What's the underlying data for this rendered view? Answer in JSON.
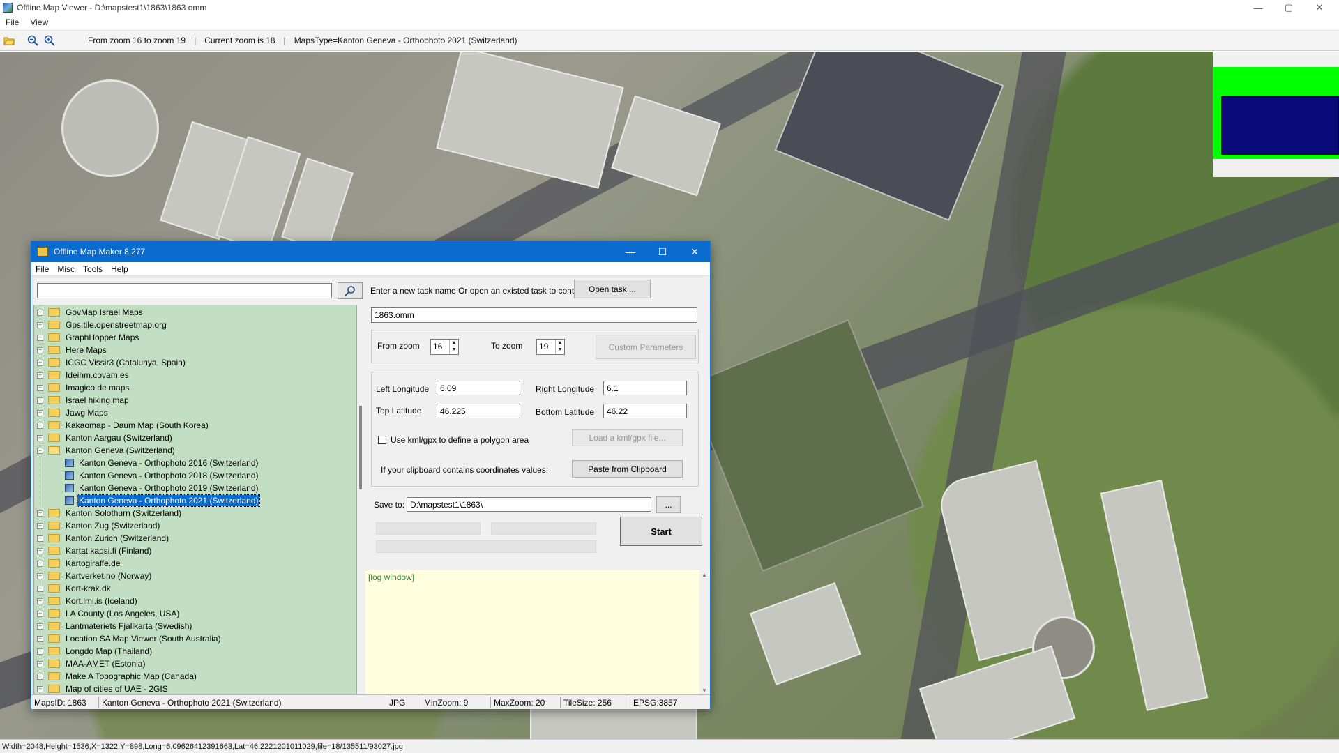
{
  "viewer": {
    "title": "Offline Map Viewer - D:\\mapstest1\\1863\\1863.omm",
    "menu": [
      "File",
      "View"
    ],
    "toolbar": {
      "zoom_range": "From zoom 16 to zoom 19",
      "current_zoom": "Current zoom is 18",
      "maps_type": "MapsType=Kanton Geneva - Orthophoto 2021 (Switzerland)",
      "separator": "|"
    },
    "status": "Width=2048,Height=1536,X=1322,Y=898,Long=6.09626412391663,Lat=46.2221201011029,file=18/135511/93027.jpg",
    "window_controls": {
      "minimize": "—",
      "maximize": "▢",
      "close": "✕"
    }
  },
  "dialog": {
    "title": "Offline Map Maker 8.277",
    "menu": [
      "File",
      "Misc",
      "Tools",
      "Help"
    ],
    "search": {
      "value": "",
      "placeholder": ""
    },
    "tree": [
      {
        "label": "GovMap Israel Maps",
        "level": 0,
        "expanded": false
      },
      {
        "label": "Gps.tile.openstreetmap.org",
        "level": 0,
        "expanded": false
      },
      {
        "label": "GraphHopper Maps",
        "level": 0,
        "expanded": false
      },
      {
        "label": "Here Maps",
        "level": 0,
        "expanded": false
      },
      {
        "label": "ICGC Vissir3 (Catalunya, Spain)",
        "level": 0,
        "expanded": false
      },
      {
        "label": "Ideihm.covam.es",
        "level": 0,
        "expanded": false
      },
      {
        "label": "Imagico.de maps",
        "level": 0,
        "expanded": false
      },
      {
        "label": "Israel hiking map",
        "level": 0,
        "expanded": false
      },
      {
        "label": "Jawg Maps",
        "level": 0,
        "expanded": false
      },
      {
        "label": "Kakaomap - Daum Map (South Korea)",
        "level": 0,
        "expanded": false
      },
      {
        "label": "Kanton Aargau (Switzerland)",
        "level": 0,
        "expanded": false
      },
      {
        "label": "Kanton Geneva (Switzerland)",
        "level": 0,
        "expanded": true
      },
      {
        "label": "Kanton Geneva - Orthophoto 2016 (Switzerland)",
        "level": 1
      },
      {
        "label": "Kanton Geneva - Orthophoto 2018 (Switzerland)",
        "level": 1
      },
      {
        "label": "Kanton Geneva - Orthophoto 2019 (Switzerland)",
        "level": 1
      },
      {
        "label": "Kanton Geneva - Orthophoto 2021 (Switzerland)",
        "level": 1,
        "selected": true
      },
      {
        "label": "Kanton Solothurn (Switzerland)",
        "level": 0,
        "expanded": false
      },
      {
        "label": "Kanton Zug (Switzerland)",
        "level": 0,
        "expanded": false
      },
      {
        "label": "Kanton Zurich (Switzerland)",
        "level": 0,
        "expanded": false
      },
      {
        "label": "Kartat.kapsi.fi (Finland)",
        "level": 0,
        "expanded": false
      },
      {
        "label": "Kartogiraffe.de",
        "level": 0,
        "expanded": false
      },
      {
        "label": "Kartverket.no (Norway)",
        "level": 0,
        "expanded": false
      },
      {
        "label": "Kort-krak.dk",
        "level": 0,
        "expanded": false
      },
      {
        "label": "Kort.lmi.is (Iceland)",
        "level": 0,
        "expanded": false
      },
      {
        "label": "LA County (Los Angeles, USA)",
        "level": 0,
        "expanded": false
      },
      {
        "label": "Lantmateriets Fjallkarta (Swedish)",
        "level": 0,
        "expanded": false
      },
      {
        "label": "Location SA Map Viewer (South Australia)",
        "level": 0,
        "expanded": false
      },
      {
        "label": "Longdo Map (Thailand)",
        "level": 0,
        "expanded": false
      },
      {
        "label": "MAA-AMET (Estonia)",
        "level": 0,
        "expanded": false
      },
      {
        "label": "Make A Topographic Map (Canada)",
        "level": 0,
        "expanded": false
      },
      {
        "label": "Map of cities of UAE - 2GIS",
        "level": 0,
        "expanded": false
      }
    ],
    "task": {
      "prompt": "Enter a new task name Or open an existed task to continue:",
      "open_task_label": "Open task ...",
      "name_value": "1863.omm"
    },
    "zoom": {
      "from_label": "From zoom",
      "from_value": "16",
      "to_label": "To zoom",
      "to_value": "19",
      "custom_params_label": "Custom Parameters"
    },
    "coords": {
      "left_lon_label": "Left Longitude",
      "left_lon_value": "6.09",
      "right_lon_label": "Right Longitude",
      "right_lon_value": "6.1",
      "top_lat_label": "Top Latitude",
      "top_lat_value": "46.225",
      "bottom_lat_label": "Bottom Latitude",
      "bottom_lat_value": "46.22",
      "kml_label": "Use kml/gpx to define a polygon area",
      "kml_checked": false,
      "load_kml_label": "Load a kml/gpx file...",
      "clipboard_prompt": "If your clipboard contains coordinates values:",
      "paste_label": "Paste from Clipboard"
    },
    "save": {
      "label": "Save to:",
      "value": "D:\\mapstest1\\1863\\",
      "browse_label": "..."
    },
    "start_label": "Start",
    "log_text": "[log window]",
    "status": {
      "maps_id": "MapsID: 1863",
      "map_name": "Kanton Geneva - Orthophoto 2021 (Switzerland)",
      "format": "JPG",
      "min_zoom": "MinZoom: 9",
      "max_zoom": "MaxZoom: 20",
      "tile_size": "TileSize: 256",
      "epsg": "EPSG:3857"
    },
    "window_controls": {
      "minimize": "—",
      "maximize": "☐",
      "close": "✕"
    }
  },
  "colors": {
    "dialog_titlebar": "#0a6ccf",
    "tree_background": "#c3dfc3",
    "selection": "#0a6ccf",
    "log_background": "#ffffe0",
    "overview_green": "#00ff00",
    "overview_box": "#0a0a7a"
  },
  "icons": [
    "open-folder-icon",
    "zoom-out-icon",
    "zoom-in-icon",
    "search-icon",
    "folder-icon",
    "map-layer-icon"
  ]
}
